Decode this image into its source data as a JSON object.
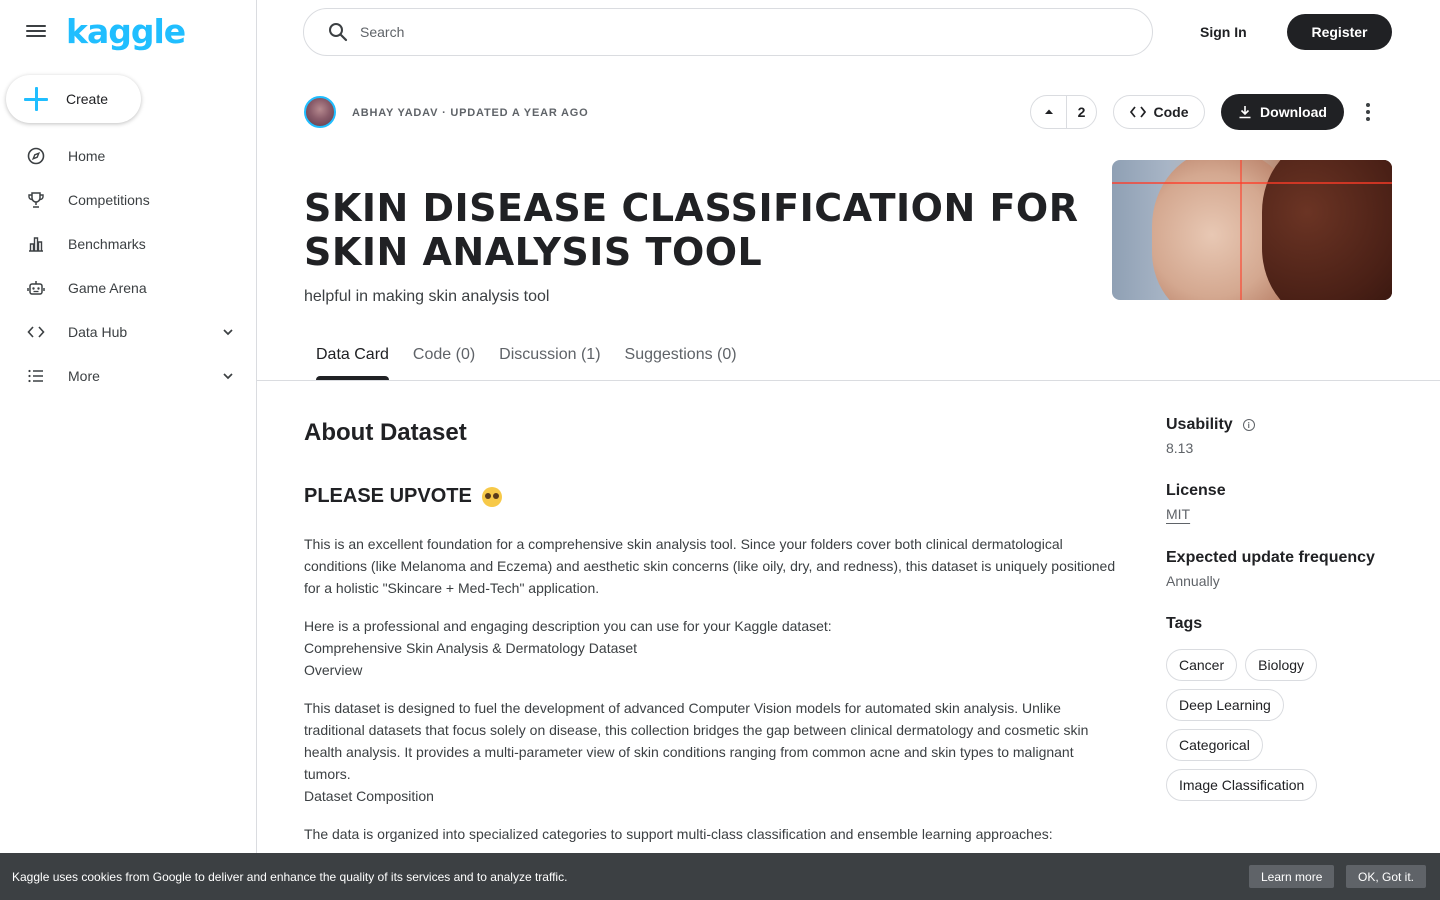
{
  "sidebar": {
    "logo": "kaggle",
    "create_label": "Create",
    "items": [
      {
        "label": "Home",
        "icon": "compass-icon"
      },
      {
        "label": "Competitions",
        "icon": "trophy-icon"
      },
      {
        "label": "Benchmarks",
        "icon": "bar-chart-icon"
      },
      {
        "label": "Game Arena",
        "icon": "robot-icon"
      },
      {
        "label": "Data Hub",
        "icon": "code-icon"
      },
      {
        "label": "More",
        "icon": "list-icon"
      }
    ]
  },
  "topbar": {
    "search_placeholder": "Search",
    "signin_label": "Sign In",
    "register_label": "Register"
  },
  "header": {
    "meta": "ABHAY YADAV · UPDATED A YEAR AGO",
    "vote_count": "2",
    "code_label": "Code",
    "download_label": "Download",
    "title": "SKIN DISEASE CLASSIFICATION FOR SKIN ANALYSIS TOOL",
    "subtitle": "helpful in making skin analysis tool"
  },
  "tabs": [
    "Data Card",
    "Code (0)",
    "Discussion (1)",
    "Suggestions (0)"
  ],
  "content": {
    "about_heading": "About Dataset",
    "upvote_heading": "PLEASE UPVOTE",
    "para1": "This is an excellent foundation for a comprehensive skin analysis tool. Since your folders cover both clinical dermatological conditions (like Melanoma and Eczema) and aesthetic skin concerns (like oily, dry, and redness), this dataset is uniquely positioned for a holistic \"Skincare + Med-Tech\" application.",
    "para2_line1": "Here is a professional and engaging description you can use for your Kaggle dataset:",
    "para2_line2": "Comprehensive Skin Analysis & Dermatology Dataset",
    "para2_line3": "Overview",
    "para3": "This dataset is designed to fuel the development of advanced Computer Vision models for automated skin analysis. Unlike traditional datasets that focus solely on disease, this collection bridges the gap between clinical dermatology and cosmetic skin health analysis. It provides a multi-parameter view of skin conditions ranging from common acne and skin types to malignant tumors.",
    "para3_line2": "Dataset Composition",
    "para4": "The data is organized into specialized categories to support multi-class classification and ensemble learning approaches:"
  },
  "side": {
    "usability_label": "Usability",
    "usability_value": "8.13",
    "license_label": "License",
    "license_value": "MIT",
    "frequency_label": "Expected update frequency",
    "frequency_value": "Annually",
    "tags_label": "Tags",
    "tags": [
      "Cancer",
      "Biology",
      "Deep Learning",
      "Categorical",
      "Image Classification"
    ]
  },
  "cookie": {
    "text": "Kaggle uses cookies from Google to deliver and enhance the quality of its services and to analyze traffic.",
    "learn_more": "Learn more",
    "ok": "OK, Got it."
  },
  "colors": {
    "brand": "#20beff",
    "dark": "#202124",
    "border": "#dadce0",
    "cookie_bg": "#3c4043"
  }
}
